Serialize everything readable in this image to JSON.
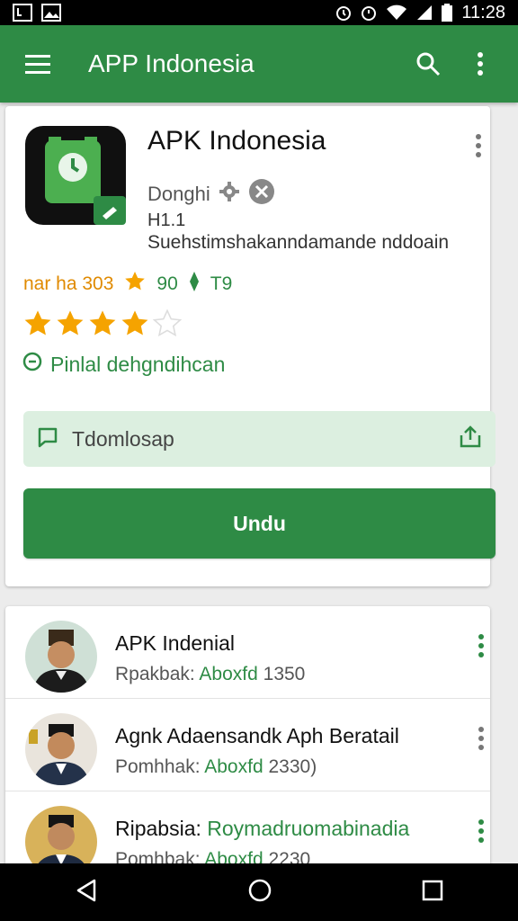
{
  "status_bar": {
    "time": "11:28"
  },
  "appbar": {
    "title": "APP Indonesia"
  },
  "app": {
    "name": "APK Indonesia",
    "developer": "Donghi",
    "version": "H1.1",
    "description": "Suehstimshakanndamande nddoain",
    "stats": {
      "left": "nar ha 303",
      "middle": "90",
      "right": "T9"
    },
    "rating": 4,
    "info_text": "Pinlal dehgndihcan",
    "search_text": "Tdomlosap",
    "download_label": "Undu"
  },
  "list": [
    {
      "title": "APK Indenial",
      "sub_prefix": "Rpakbak:",
      "sub_green": "Aboxfd",
      "sub_suffix": "1350"
    },
    {
      "title": "Agnk Adaensandk Aph Beratail",
      "sub_prefix": "Pomhhak:",
      "sub_green": "Aboxfd",
      "sub_suffix": "2330)"
    },
    {
      "title_prefix": "Ripabsia:",
      "title_green": "Roymadruomabinadia",
      "sub_prefix": "Pomhbak:",
      "sub_green": "Aboxfd",
      "sub_suffix": "2230"
    }
  ],
  "colors": {
    "primary": "#2e8b45",
    "accent_orange": "#e08a00",
    "pill": "#dcefe0"
  }
}
